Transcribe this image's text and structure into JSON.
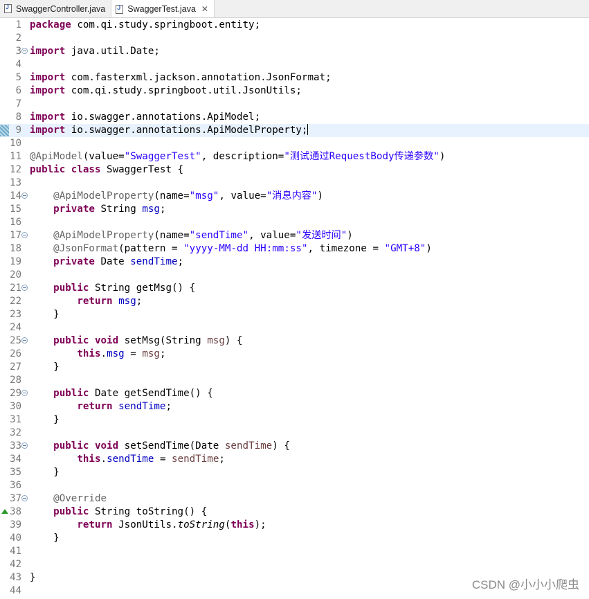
{
  "tabs": [
    {
      "label": "SwaggerController.java",
      "active": false
    },
    {
      "label": "SwaggerTest.java",
      "active": true,
      "close": "✕"
    }
  ],
  "colors": {
    "keyword": "#7f0055",
    "annotation": "#646464",
    "string": "#2a00ff",
    "field": "#0000c0",
    "parameter": "#6a3e3e",
    "line_number": "#787878",
    "current_line": "#e8f2fe"
  },
  "icons": [
    "java-file-icon",
    "fold-collapse-icon",
    "override-marker-icon",
    "change-marker-icon"
  ],
  "lines": [
    {
      "n": "1",
      "tokens": [
        [
          "kw",
          "package"
        ],
        [
          "",
          "com.qi.study.springboot.entity;"
        ]
      ]
    },
    {
      "n": "2",
      "tokens": []
    },
    {
      "n": "3",
      "fold": true,
      "tokens": [
        [
          "kw",
          "import"
        ],
        [
          "",
          "java.util.Date;"
        ]
      ]
    },
    {
      "n": "4",
      "tokens": []
    },
    {
      "n": "5",
      "tokens": [
        [
          "kw",
          "import"
        ],
        [
          "",
          "com.fasterxml.jackson.annotation.JsonFormat;"
        ]
      ]
    },
    {
      "n": "6",
      "tokens": [
        [
          "kw",
          "import"
        ],
        [
          "",
          "com.qi.study.springboot.util.JsonUtils;"
        ]
      ]
    },
    {
      "n": "7",
      "tokens": []
    },
    {
      "n": "8",
      "tokens": [
        [
          "kw",
          "import"
        ],
        [
          "",
          "io.swagger.annotations.ApiModel;"
        ]
      ]
    },
    {
      "n": "9",
      "current": true,
      "change": true,
      "caret": true,
      "tokens": [
        [
          "kw",
          "import"
        ],
        [
          "",
          "io.swagger.annotations.ApiModelProperty;"
        ]
      ]
    },
    {
      "n": "10",
      "tokens": []
    },
    {
      "n": "11",
      "tokens": [
        [
          "ann",
          "@ApiModel"
        ],
        [
          "",
          "(value="
        ],
        [
          "str",
          "\"SwaggerTest\""
        ],
        [
          "",
          ", description="
        ],
        [
          "str",
          "\"测试通过RequestBody传递参数\""
        ],
        [
          "",
          ")"
        ]
      ]
    },
    {
      "n": "12",
      "tokens": [
        [
          "kw",
          "public"
        ],
        [
          "",
          " "
        ],
        [
          "kw",
          "class"
        ],
        [
          "",
          " SwaggerTest {"
        ]
      ]
    },
    {
      "n": "13",
      "tokens": []
    },
    {
      "n": "14",
      "fold": true,
      "tokens": [
        [
          "",
          "    "
        ],
        [
          "ann",
          "@ApiModelProperty"
        ],
        [
          "",
          "(name="
        ],
        [
          "str",
          "\"msg\""
        ],
        [
          "",
          ", value="
        ],
        [
          "str",
          "\"消息内容\""
        ],
        [
          "",
          ")"
        ]
      ]
    },
    {
      "n": "15",
      "tokens": [
        [
          "",
          "    "
        ],
        [
          "kw",
          "private"
        ],
        [
          "",
          " String "
        ],
        [
          "fld",
          "msg"
        ],
        [
          "",
          ";"
        ]
      ]
    },
    {
      "n": "16",
      "tokens": []
    },
    {
      "n": "17",
      "fold": true,
      "tokens": [
        [
          "",
          "    "
        ],
        [
          "ann",
          "@ApiModelProperty"
        ],
        [
          "",
          "(name="
        ],
        [
          "str",
          "\"sendTime\""
        ],
        [
          "",
          ", value="
        ],
        [
          "str",
          "\"发送时间\""
        ],
        [
          "",
          ")"
        ]
      ]
    },
    {
      "n": "18",
      "tokens": [
        [
          "",
          "    "
        ],
        [
          "ann",
          "@JsonFormat"
        ],
        [
          "",
          "(pattern = "
        ],
        [
          "str",
          "\"yyyy-MM-dd HH:mm:ss\""
        ],
        [
          "",
          ", timezone = "
        ],
        [
          "str",
          "\"GMT+8\""
        ],
        [
          "",
          ")"
        ]
      ]
    },
    {
      "n": "19",
      "tokens": [
        [
          "",
          "    "
        ],
        [
          "kw",
          "private"
        ],
        [
          "",
          " Date "
        ],
        [
          "fld",
          "sendTime"
        ],
        [
          "",
          ";"
        ]
      ]
    },
    {
      "n": "20",
      "tokens": []
    },
    {
      "n": "21",
      "fold": true,
      "tokens": [
        [
          "",
          "    "
        ],
        [
          "kw",
          "public"
        ],
        [
          "",
          " String getMsg() {"
        ]
      ]
    },
    {
      "n": "22",
      "tokens": [
        [
          "",
          "        "
        ],
        [
          "kw",
          "return"
        ],
        [
          "",
          " "
        ],
        [
          "fld",
          "msg"
        ],
        [
          "",
          ";"
        ]
      ]
    },
    {
      "n": "23",
      "tokens": [
        [
          "",
          "    }"
        ]
      ]
    },
    {
      "n": "24",
      "tokens": []
    },
    {
      "n": "25",
      "fold": true,
      "tokens": [
        [
          "",
          "    "
        ],
        [
          "kw",
          "public"
        ],
        [
          "",
          " "
        ],
        [
          "kw",
          "void"
        ],
        [
          "",
          " setMsg(String "
        ],
        [
          "param",
          "msg"
        ],
        [
          "",
          ") {"
        ]
      ]
    },
    {
      "n": "26",
      "tokens": [
        [
          "",
          "        "
        ],
        [
          "kw",
          "this"
        ],
        [
          "",
          "."
        ],
        [
          "fld",
          "msg"
        ],
        [
          "",
          " = "
        ],
        [
          "param",
          "msg"
        ],
        [
          "",
          ";"
        ]
      ]
    },
    {
      "n": "27",
      "tokens": [
        [
          "",
          "    }"
        ]
      ]
    },
    {
      "n": "28",
      "tokens": []
    },
    {
      "n": "29",
      "fold": true,
      "tokens": [
        [
          "",
          "    "
        ],
        [
          "kw",
          "public"
        ],
        [
          "",
          " Date getSendTime() {"
        ]
      ]
    },
    {
      "n": "30",
      "tokens": [
        [
          "",
          "        "
        ],
        [
          "kw",
          "return"
        ],
        [
          "",
          " "
        ],
        [
          "fld",
          "sendTime"
        ],
        [
          "",
          ";"
        ]
      ]
    },
    {
      "n": "31",
      "tokens": [
        [
          "",
          "    }"
        ]
      ]
    },
    {
      "n": "32",
      "tokens": []
    },
    {
      "n": "33",
      "fold": true,
      "tokens": [
        [
          "",
          "    "
        ],
        [
          "kw",
          "public"
        ],
        [
          "",
          " "
        ],
        [
          "kw",
          "void"
        ],
        [
          "",
          " setSendTime(Date "
        ],
        [
          "param",
          "sendTime"
        ],
        [
          "",
          ") {"
        ]
      ]
    },
    {
      "n": "34",
      "tokens": [
        [
          "",
          "        "
        ],
        [
          "kw",
          "this"
        ],
        [
          "",
          "."
        ],
        [
          "fld",
          "sendTime"
        ],
        [
          "",
          " = "
        ],
        [
          "param",
          "sendTime"
        ],
        [
          "",
          ";"
        ]
      ]
    },
    {
      "n": "35",
      "tokens": [
        [
          "",
          "    }"
        ]
      ]
    },
    {
      "n": "36",
      "tokens": []
    },
    {
      "n": "37",
      "fold": true,
      "tokens": [
        [
          "",
          "    "
        ],
        [
          "ann",
          "@Override"
        ]
      ]
    },
    {
      "n": "38",
      "override": true,
      "tokens": [
        [
          "",
          "    "
        ],
        [
          "kw",
          "public"
        ],
        [
          "",
          " String toString() {"
        ]
      ]
    },
    {
      "n": "39",
      "tokens": [
        [
          "",
          "        "
        ],
        [
          "kw",
          "return"
        ],
        [
          "",
          " JsonUtils."
        ],
        [
          "ital",
          "toString"
        ],
        [
          "",
          "("
        ],
        [
          "kw",
          "this"
        ],
        [
          "",
          ");"
        ]
      ]
    },
    {
      "n": "40",
      "tokens": [
        [
          "",
          "    }"
        ]
      ]
    },
    {
      "n": "41",
      "tokens": []
    },
    {
      "n": "42",
      "tokens": []
    },
    {
      "n": "43",
      "tokens": [
        [
          "",
          "}"
        ]
      ]
    },
    {
      "n": "44",
      "tokens": []
    }
  ],
  "watermark": "CSDN @小小小爬虫"
}
